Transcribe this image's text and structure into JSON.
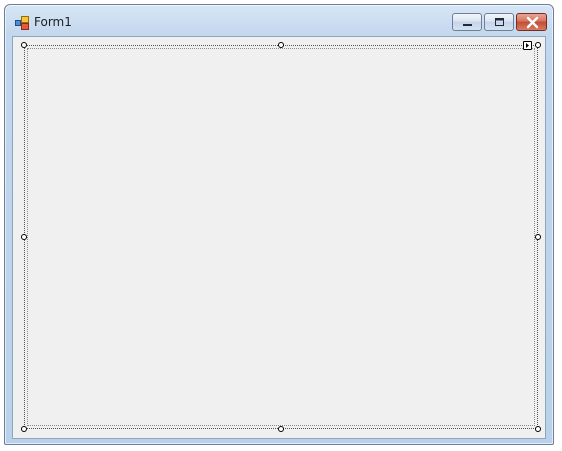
{
  "window": {
    "title": "Form1"
  },
  "icons": {
    "app": "form-icon",
    "minimize": "minimize-icon",
    "maximize": "maximize-icon",
    "close": "close-icon",
    "smart_tag": "smart-tag-arrow-icon"
  },
  "colors": {
    "client_background": "#f0f0f0",
    "title_bar": "#c3d7ee",
    "close_button": "#c24d33"
  }
}
